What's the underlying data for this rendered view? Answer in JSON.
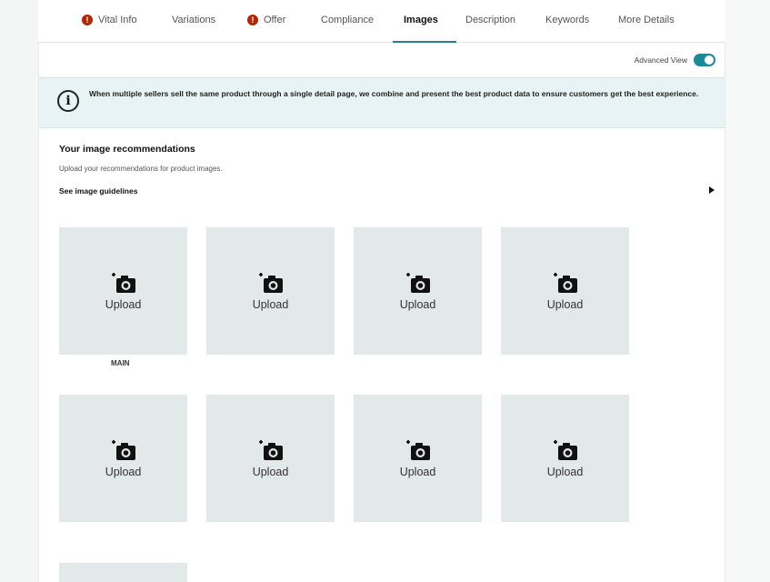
{
  "tabs": [
    {
      "label": "Vital Info",
      "error": true
    },
    {
      "label": "Variations",
      "error": false
    },
    {
      "label": "Offer",
      "error": true
    },
    {
      "label": "Compliance",
      "error": false
    },
    {
      "label": "Images",
      "error": false,
      "active": true
    },
    {
      "label": "Description",
      "error": false
    },
    {
      "label": "Keywords",
      "error": false
    },
    {
      "label": "More Details",
      "error": false
    }
  ],
  "tab_error_glyph": "!",
  "advanced_view": {
    "label": "Advanced View",
    "enabled": true
  },
  "banner": {
    "icon": "info-icon",
    "icon_glyph": "i",
    "text": "When multiple sellers sell the same product through a single detail page, we combine and present the best product data to ensure customers get the best experience."
  },
  "recommendations": {
    "title": "Your image recommendations",
    "subtitle": "Upload your recommendations for product images.",
    "guidelines_link": "See image guidelines"
  },
  "tiles": [
    {
      "label": "Upload",
      "caption": "MAIN"
    },
    {
      "label": "Upload"
    },
    {
      "label": "Upload"
    },
    {
      "label": "Upload"
    },
    {
      "label": "Upload"
    },
    {
      "label": "Upload"
    },
    {
      "label": "Upload"
    },
    {
      "label": "Upload"
    }
  ],
  "colors": {
    "accent": "#2a7f86",
    "toggle_on": "#1b8a99",
    "error": "#b12704",
    "banner_bg": "#e7f3f5",
    "tile_bg": "#e3e8e8"
  }
}
